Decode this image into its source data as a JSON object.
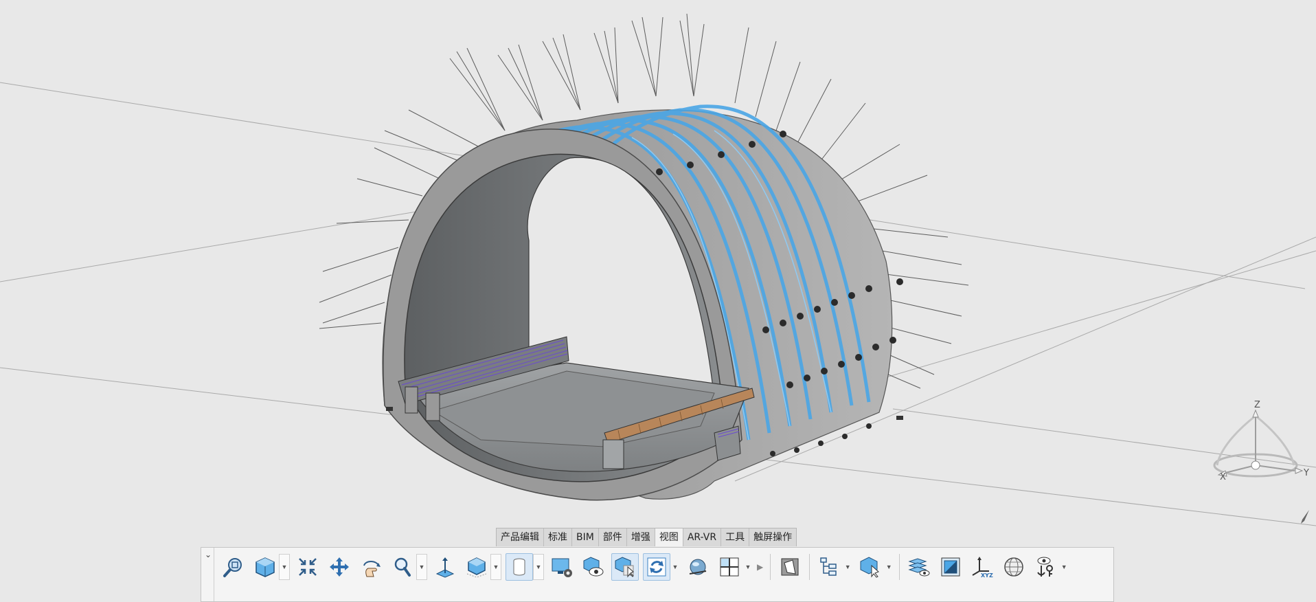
{
  "viewport": {
    "axes": {
      "z": "Z",
      "x": "X",
      "y": "Y"
    }
  },
  "tabs": [
    "产品编辑",
    "标准",
    "BIM",
    "部件",
    "增强",
    "视图",
    "AR-VR",
    "工具",
    "触屏操作"
  ],
  "active_tab": "视图",
  "toolbar": {
    "tools": [
      "zoom-fit-icon",
      "view-cube-icon",
      "shrink-icon",
      "pan-icon",
      "rotate-hand-icon",
      "zoom-icon",
      "normal-view-icon",
      "render-mode-icon",
      "cylinder-display-icon",
      "display-settings-icon",
      "visibility-eye-icon",
      "select-filter-icon",
      "refresh-icon",
      "lighting-icon",
      "split-view-icon",
      "clipping-icon",
      "tree-icon",
      "pick-object-icon",
      "layers-visibility-icon",
      "section-view-icon",
      "xyz-axes-icon",
      "globe-icon",
      "show-hide-anchor-icon"
    ]
  },
  "colors": {
    "accent": "#3a90d8",
    "background": "#e8e8e8",
    "tunnel_gray": "#9a9a9a",
    "steel_rib_blue": "#4aa6e6"
  }
}
